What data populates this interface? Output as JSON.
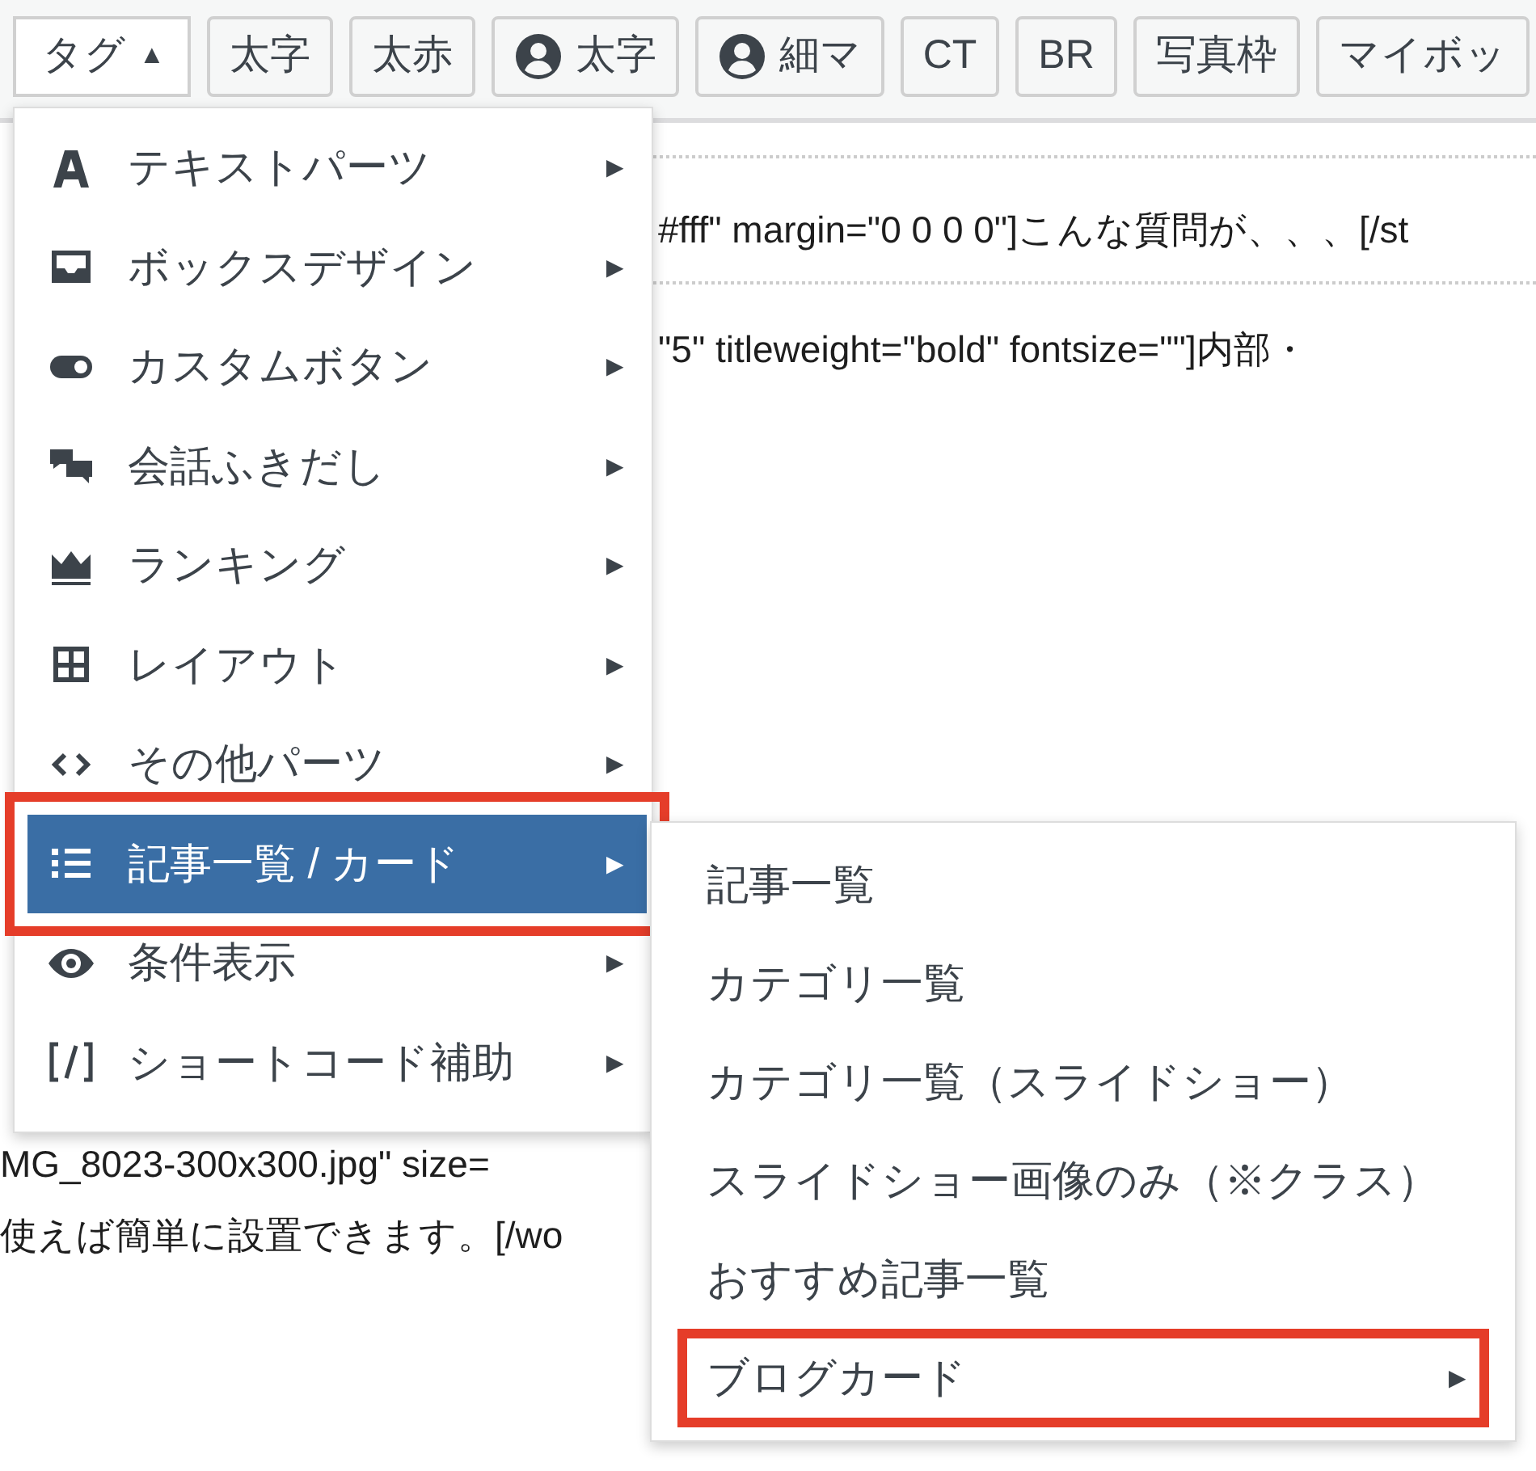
{
  "toolbar": {
    "buttons": [
      {
        "kind": "dropdown",
        "label": "タグ",
        "caret": "▲"
      },
      {
        "kind": "plain",
        "label": "太字"
      },
      {
        "kind": "plain",
        "label": "太赤"
      },
      {
        "kind": "user",
        "label": "太字"
      },
      {
        "kind": "user",
        "label": "細マ"
      },
      {
        "kind": "plain",
        "label": "CT"
      },
      {
        "kind": "plain",
        "label": "BR"
      },
      {
        "kind": "plain",
        "label": "写真枠"
      },
      {
        "kind": "plain",
        "label": "マイボッ"
      }
    ]
  },
  "editor": {
    "lines": [
      {
        "right": "#fff\" margin=\"0 0 0 0\"]こんな質問が、、、[/st"
      },
      {
        "right": "\"5\" titleweight=\"bold\" fontsize=\"\"]内部・"
      },
      {
        "left": "MG_8023-300x300.jpg\" size="
      },
      {
        "left": "使えば簡単に設置できます。[/wo"
      }
    ]
  },
  "menu": {
    "items": [
      {
        "label": "テキストパーツ",
        "arrow": "▶",
        "selected": false,
        "annotated": false
      },
      {
        "label": "ボックスデザイン",
        "arrow": "▶",
        "selected": false,
        "annotated": false
      },
      {
        "label": "カスタムボタン",
        "arrow": "▶",
        "selected": false,
        "annotated": false
      },
      {
        "label": "会話ふきだし",
        "arrow": "▶",
        "selected": false,
        "annotated": false
      },
      {
        "label": "ランキング",
        "arrow": "▶",
        "selected": false,
        "annotated": false
      },
      {
        "label": "レイアウト",
        "arrow": "▶",
        "selected": false,
        "annotated": false
      },
      {
        "label": "その他パーツ",
        "arrow": "▶",
        "selected": false,
        "annotated": false
      },
      {
        "label": "記事一覧 / カード",
        "arrow": "▶",
        "selected": true,
        "annotated": true
      },
      {
        "label": "条件表示",
        "arrow": "▶",
        "selected": false,
        "annotated": false
      },
      {
        "label": "ショートコード補助",
        "arrow": "▶",
        "selected": false,
        "annotated": false
      }
    ]
  },
  "submenu": {
    "items": [
      {
        "label": "記事一覧",
        "annotated": false
      },
      {
        "label": "カテゴリ一覧",
        "annotated": false
      },
      {
        "label": "カテゴリ一覧（スライドショー）",
        "annotated": false
      },
      {
        "label": "スライドショー画像のみ（※クラス）",
        "annotated": false
      },
      {
        "label": "おすすめ記事一覧",
        "annotated": false
      },
      {
        "label": "ブログカード",
        "arrow": "▶",
        "annotated": true
      }
    ]
  }
}
